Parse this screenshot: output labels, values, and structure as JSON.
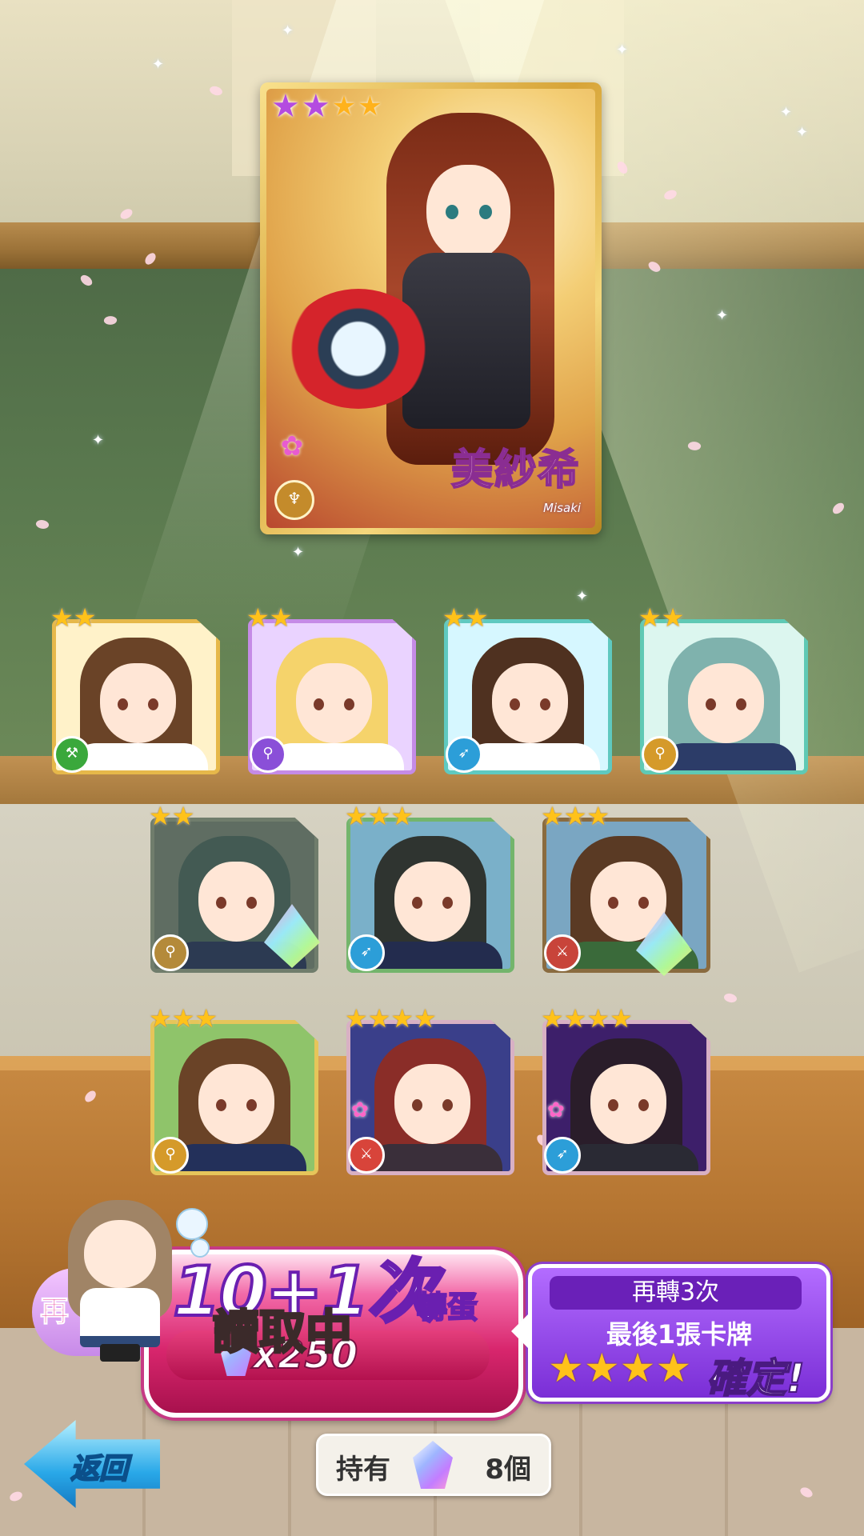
{
  "featured_card": {
    "name": "美紗希",
    "name_romaji": "Misaki",
    "stars_filled": 2,
    "stars_total": 4,
    "type_icon": "claw-icon"
  },
  "cards_row1": [
    {
      "stars": 2,
      "type_icon": "axe-icon",
      "type_color": "#3aa83c",
      "frame_color": "#e6b84a",
      "bg": "#fff2c9",
      "hair": "#6a4327",
      "cloth": "#ffffff"
    },
    {
      "stars": 2,
      "type_icon": "staff-icon",
      "type_color": "#8a4fd8",
      "frame_color": "#c58be6",
      "bg": "#ead3ff",
      "hair": "#f5d36b",
      "cloth": "#ffffff"
    },
    {
      "stars": 2,
      "type_icon": "gun-icon",
      "type_color": "#2c9ed8",
      "frame_color": "#5fc9c0",
      "bg": "#d6f7ff",
      "hair": "#4f3120",
      "cloth": "#ffffff"
    },
    {
      "stars": 2,
      "type_icon": "spear-icon",
      "type_color": "#d59a2a",
      "frame_color": "#5fc9b4",
      "bg": "#dcf6ef",
      "hair": "#7fb2ad",
      "cloth": "#2c3c68"
    }
  ],
  "cards_row2": [
    {
      "stars": 2,
      "type_icon": "spear-icon",
      "type_color": "#b48a3a",
      "frame_color": "#707d6c",
      "bg": "#5f6d62",
      "hair": "#435a53",
      "cloth": "#2c3a52"
    },
    {
      "stars": 3,
      "type_icon": "gun-icon",
      "type_color": "#2c9ed8",
      "frame_color": "#73b56c",
      "bg": "#7ab0c9",
      "hair": "#2f3430",
      "cloth": "#232c4e"
    },
    {
      "stars": 3,
      "type_icon": "sword-icon",
      "type_color": "#c8443a",
      "frame_color": "#8a6b3f",
      "bg": "#7aa6c2",
      "hair": "#5a3a24",
      "cloth": "#3a6a3a"
    }
  ],
  "cards_row3": [
    {
      "stars": 3,
      "type_icon": "spear-icon",
      "type_color": "#d59a2a",
      "frame_color": "#e6c55a",
      "bg": "#8fc46a",
      "hair": "#6a4327",
      "cloth": "#23305a"
    },
    {
      "stars": 4,
      "type_icon": "sword-icon",
      "type_color": "#d8443a",
      "frame_color": "#d8b0c4",
      "bg": "#3a3f8a",
      "hair": "#8a2d28",
      "cloth": "#3a2f3a"
    },
    {
      "stars": 4,
      "type_icon": "gun-icon",
      "type_color": "#2c9ed8",
      "frame_color": "#d8b0c4",
      "bg": "#3d1f6a",
      "hair": "#2a1d2a",
      "cloth": "#2a2a34"
    }
  ],
  "gacha_button": {
    "title": "10+1次",
    "subtitle": "轉蛋",
    "cost": "x250",
    "loading": "讀取中",
    "again_prefix": "再"
  },
  "bonus_panel": {
    "line1": "再轉3次",
    "line2": "最後1張卡牌",
    "confirm": "確定!",
    "stars": 4
  },
  "back_button": {
    "label": "返回"
  },
  "owned": {
    "label": "持有",
    "count": "8個",
    "gem_icon": "crystal-icon"
  },
  "colors": {
    "accent_pink": "#d8266d",
    "accent_purple": "#7a2ed6",
    "star_gold": "#ffc21a",
    "back_blue": "#29a8e8"
  }
}
